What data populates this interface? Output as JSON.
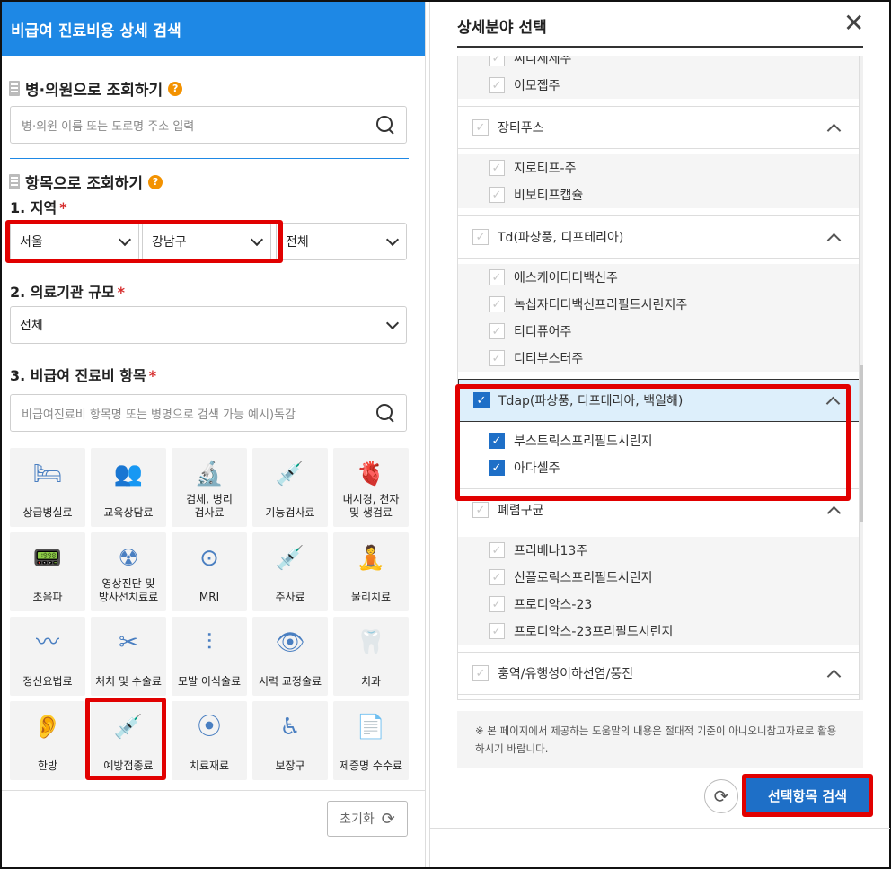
{
  "left": {
    "header_title": "비급여 진료비용 상세 검색",
    "hospital_section": {
      "title": "병·의원으로 조회하기",
      "help": "?",
      "search_placeholder": "병·의원 이름 또는 도로명 주소 입력"
    },
    "item_section": {
      "title": "항목으로 조회하기",
      "help": "?",
      "region_label": "1. 지역",
      "required_mark": "*",
      "region_selects": [
        "서울",
        "강남구",
        "전체"
      ],
      "scale_label": "2. 의료기관 규모",
      "scale_value": "전체",
      "item_label": "3. 비급여 진료비 항목",
      "item_placeholder": "비급여진료비 항목명 또는 병명으로 검색 가능 예시)독감"
    },
    "categories": [
      {
        "name": "상급병실료",
        "icon": "hospital-bed-icon",
        "glyph": "🛏"
      },
      {
        "name": "교육상담료",
        "icon": "consultation-icon",
        "glyph": "👥"
      },
      {
        "name": "검체, 병리\n검사료",
        "icon": "specimen-icon",
        "glyph": "🔬"
      },
      {
        "name": "기능검사료",
        "icon": "function-test-icon",
        "glyph": "💉"
      },
      {
        "name": "내시경, 천자\n및 생검료",
        "icon": "endoscope-icon",
        "glyph": "🫀"
      },
      {
        "name": "초음파",
        "icon": "ultrasound-icon",
        "glyph": "📟"
      },
      {
        "name": "영상진단 및\n방사선치료료",
        "icon": "radiology-icon",
        "glyph": "☢"
      },
      {
        "name": "MRI",
        "icon": "mri-icon",
        "glyph": "⊙"
      },
      {
        "name": "주사료",
        "icon": "syringe-icon",
        "glyph": "💉"
      },
      {
        "name": "물리치료",
        "icon": "physical-therapy-icon",
        "glyph": "🧘"
      },
      {
        "name": "정신요법료",
        "icon": "brain-wave-icon",
        "glyph": "〰"
      },
      {
        "name": "처치 및 수술료",
        "icon": "surgery-icon",
        "glyph": "✂"
      },
      {
        "name": "모발 이식술료",
        "icon": "hair-transplant-icon",
        "glyph": "⫶"
      },
      {
        "name": "시력 교정술료",
        "icon": "eye-icon",
        "glyph": "👁"
      },
      {
        "name": "치과",
        "icon": "tooth-icon",
        "glyph": "🦷"
      },
      {
        "name": "한방",
        "icon": "ear-acupuncture-icon",
        "glyph": "👂"
      },
      {
        "name": "예방접종료",
        "icon": "vaccination-icon",
        "glyph": "💉"
      },
      {
        "name": "치료재료",
        "icon": "treatment-material-icon",
        "glyph": "⦿"
      },
      {
        "name": "보장구",
        "icon": "wheelchair-icon",
        "glyph": "♿"
      },
      {
        "name": "제증명 수수료",
        "icon": "certificate-icon",
        "glyph": "📄"
      }
    ],
    "reset_label": "초기화"
  },
  "right": {
    "title": "상세분야 선택",
    "close": "✕",
    "items": [
      {
        "type": "sub",
        "label": "씨디제세주",
        "checked": false
      },
      {
        "type": "sub",
        "label": "이모젭주",
        "checked": false
      },
      {
        "type": "group",
        "label": "장티푸스",
        "checked": false
      },
      {
        "type": "sub",
        "label": "지로티프-주",
        "checked": false
      },
      {
        "type": "sub",
        "label": "비보티프캡슐",
        "checked": false
      },
      {
        "type": "group",
        "label": "Td(파상풍, 디프테리아)",
        "checked": false
      },
      {
        "type": "sub",
        "label": "에스케이티디백신주",
        "checked": false
      },
      {
        "type": "sub",
        "label": "녹십자티디백신프리필드시린지주",
        "checked": false
      },
      {
        "type": "sub",
        "label": "티디퓨어주",
        "checked": false
      },
      {
        "type": "sub",
        "label": "디티부스터주",
        "checked": false
      },
      {
        "type": "group",
        "label": "Tdap(파상풍, 디프테리아, 백일해)",
        "checked": true,
        "selected": true
      },
      {
        "type": "sub",
        "label": "부스트릭스프리필드시린지",
        "checked": true
      },
      {
        "type": "sub",
        "label": "아다셀주",
        "checked": true
      },
      {
        "type": "group",
        "label": "폐렴구균",
        "checked": false
      },
      {
        "type": "sub",
        "label": "프리베나13주",
        "checked": false
      },
      {
        "type": "sub",
        "label": "신플로릭스프리필드시린지",
        "checked": false
      },
      {
        "type": "sub",
        "label": "프로디악스-23",
        "checked": false
      },
      {
        "type": "sub",
        "label": "프로디악스-23프리필드시린지",
        "checked": false
      },
      {
        "type": "group",
        "label": "훙역/유행성이하선염/풍진",
        "checked": false
      }
    ],
    "notice": "※ 본 페이지에서 제공하는 도움말의 내용은 절대적 기준이 아니오니참고자료로 활용하시기 바랍니다.",
    "search_button": "선택항목 검색"
  },
  "colors": {
    "accent": "#1e88e5",
    "button": "#1e6fc7",
    "highlight": "#e10000"
  }
}
